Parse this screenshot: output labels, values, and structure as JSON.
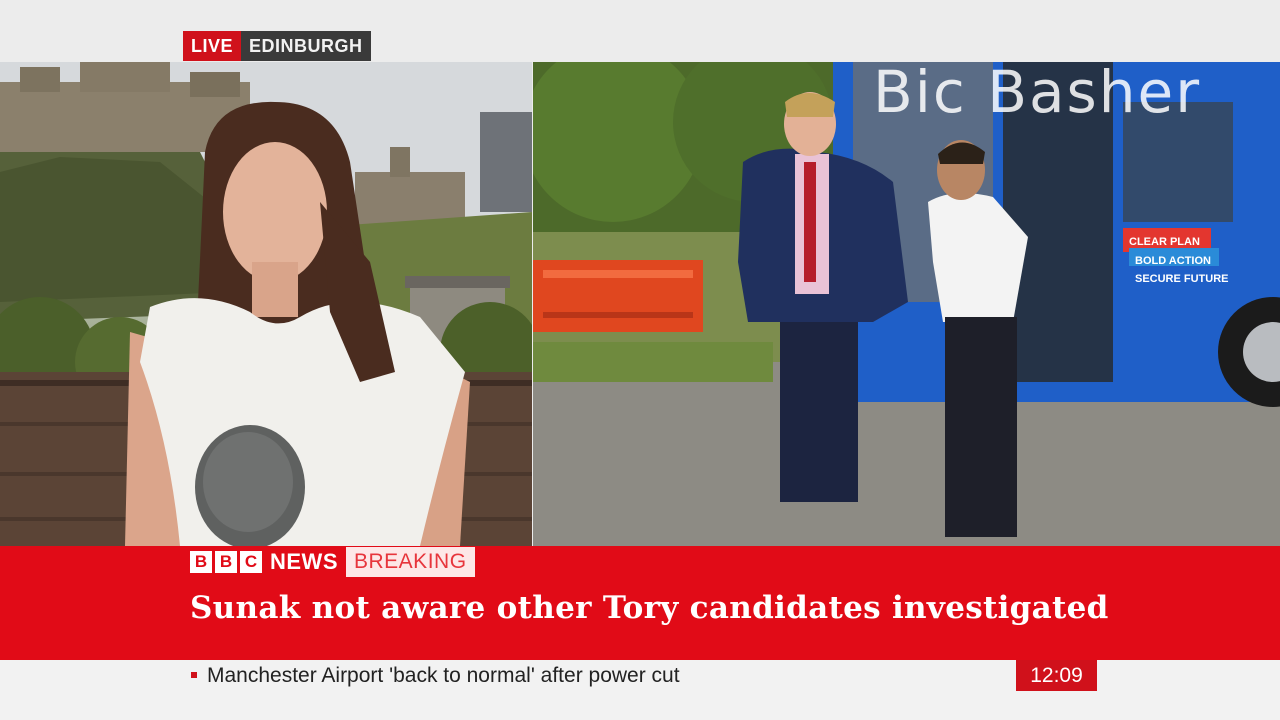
{
  "live_tag": {
    "live": "LIVE",
    "location": "EDINBURGH"
  },
  "watermark": "Bic Basher",
  "brand": {
    "b1": "B",
    "b2": "B",
    "b3": "C",
    "news": "NEWS",
    "breaking": "BREAKING"
  },
  "headline": "Sunak not aware other Tory candidates investigated",
  "ticker": {
    "text": "Manchester Airport 'back to normal' after power cut"
  },
  "clock": "12:09",
  "bus_slogans": [
    "CLEAR PLAN",
    "BOLD ACTION",
    "SECURE FUTURE"
  ],
  "colors": {
    "bbc_red": "#e10b17",
    "live_red": "#d0111b",
    "bus_blue": "#1f5fc8",
    "ticker_bg": "#f2f2f2"
  }
}
